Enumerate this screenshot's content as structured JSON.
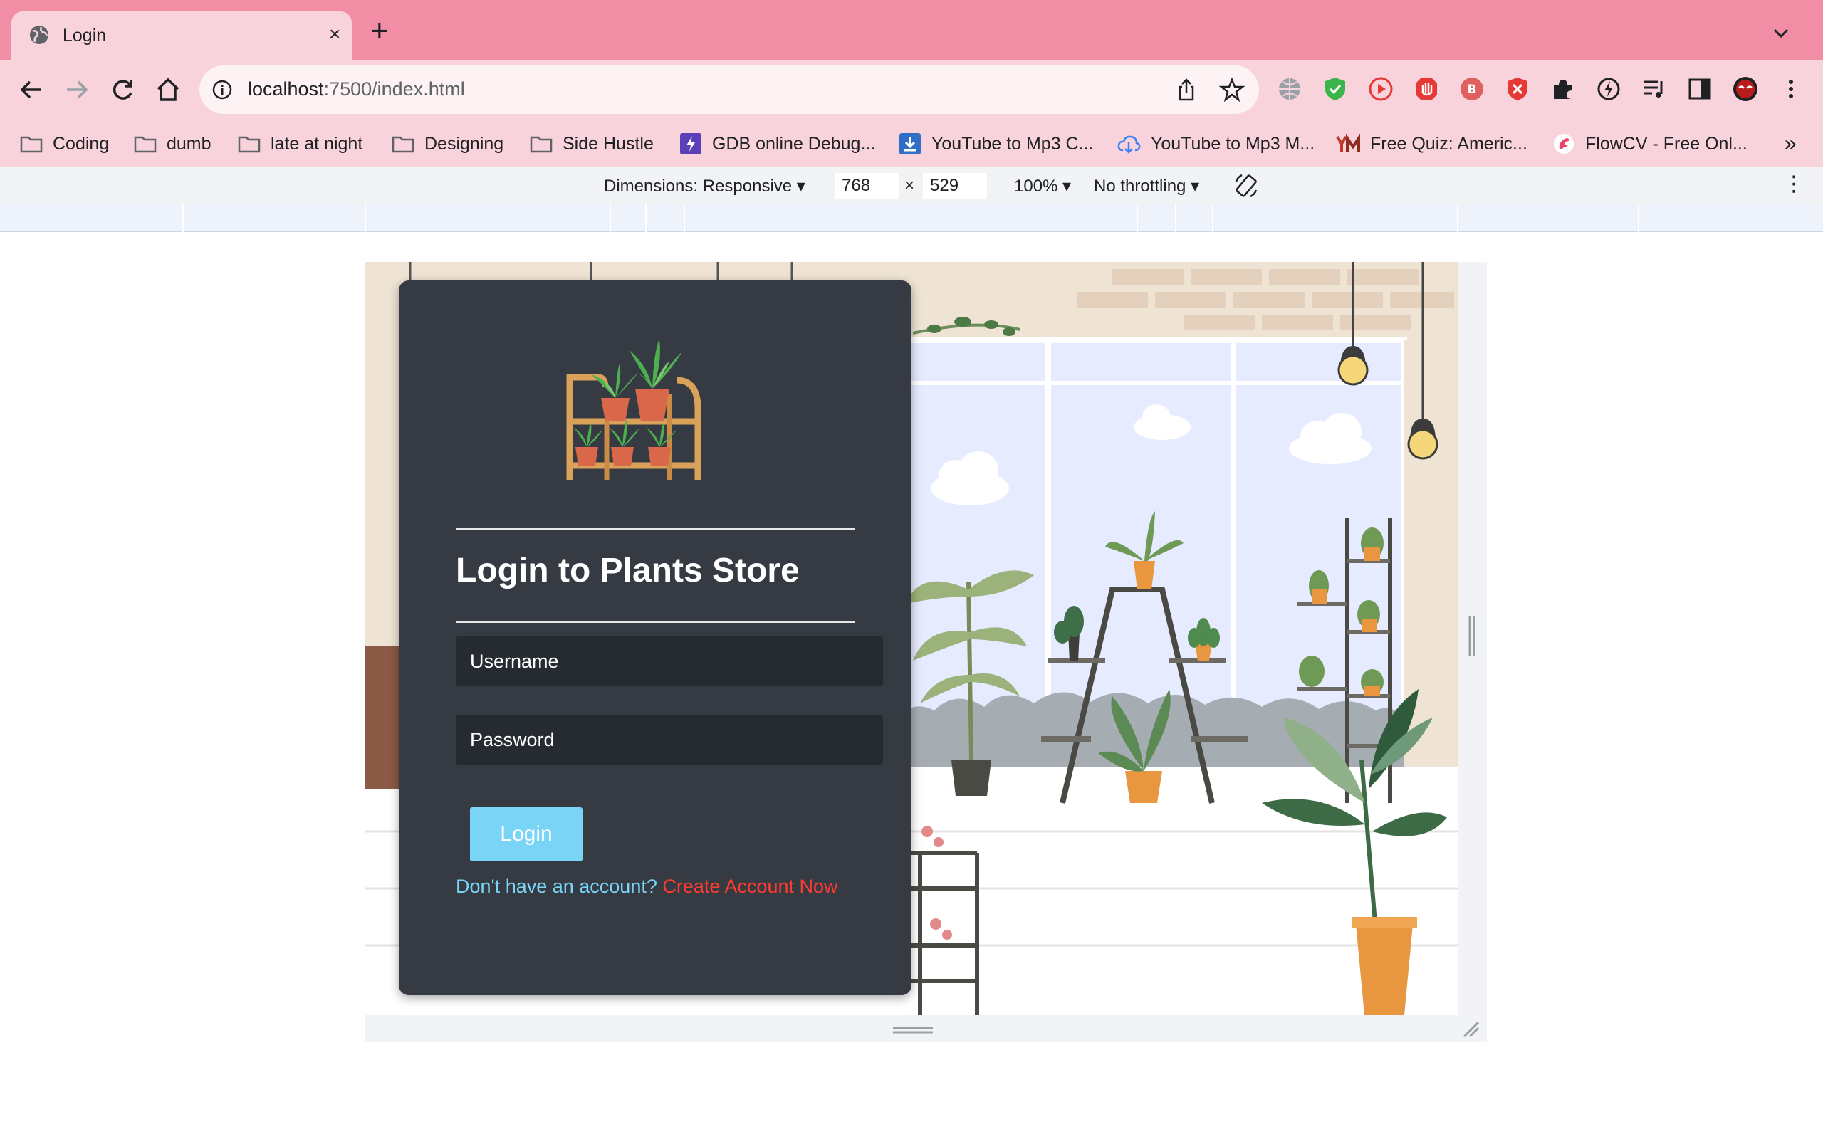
{
  "tab": {
    "title": "Login",
    "close": "×",
    "new_tab": "+"
  },
  "address_bar": {
    "host": "localhost",
    "rest": ":7500/index.html"
  },
  "bookmarks": [
    {
      "label": "Coding",
      "icon": "folder-icon"
    },
    {
      "label": "dumb",
      "icon": "folder-icon"
    },
    {
      "label": "late at night",
      "icon": "folder-icon"
    },
    {
      "label": "Designing",
      "icon": "folder-icon"
    },
    {
      "label": "Side Hustle",
      "icon": "folder-icon"
    },
    {
      "label": "GDB online Debug...",
      "icon": "gdb-icon"
    },
    {
      "label": "YouTube to Mp3 C...",
      "icon": "download-icon"
    },
    {
      "label": "YouTube to Mp3 M...",
      "icon": "cloud-download-icon"
    },
    {
      "label": "Free Quiz: Americ...",
      "icon": "ym-logo-icon"
    },
    {
      "label": "FlowCV - Free Onl...",
      "icon": "flowcv-icon"
    }
  ],
  "bookmarks_more": "»",
  "devtools": {
    "dimensions_label": "Dimensions: Responsive ▾",
    "width": "768",
    "times": "×",
    "height": "529",
    "zoom": "100% ▾",
    "throttling": "No throttling ▾",
    "more": "⋮"
  },
  "login": {
    "title": "Login to Plants Store",
    "username_placeholder": "Username",
    "password_placeholder": "Password",
    "button": "Login",
    "question": "Don't have an account?",
    "create_link": "Create Account Now"
  },
  "colors": {
    "tabstrip": "#f18ea6",
    "toolbar": "#f9d3dc",
    "card": "#353a43",
    "input": "#262a31",
    "button": "#7ad4f5",
    "link": "#ff3b2f"
  }
}
